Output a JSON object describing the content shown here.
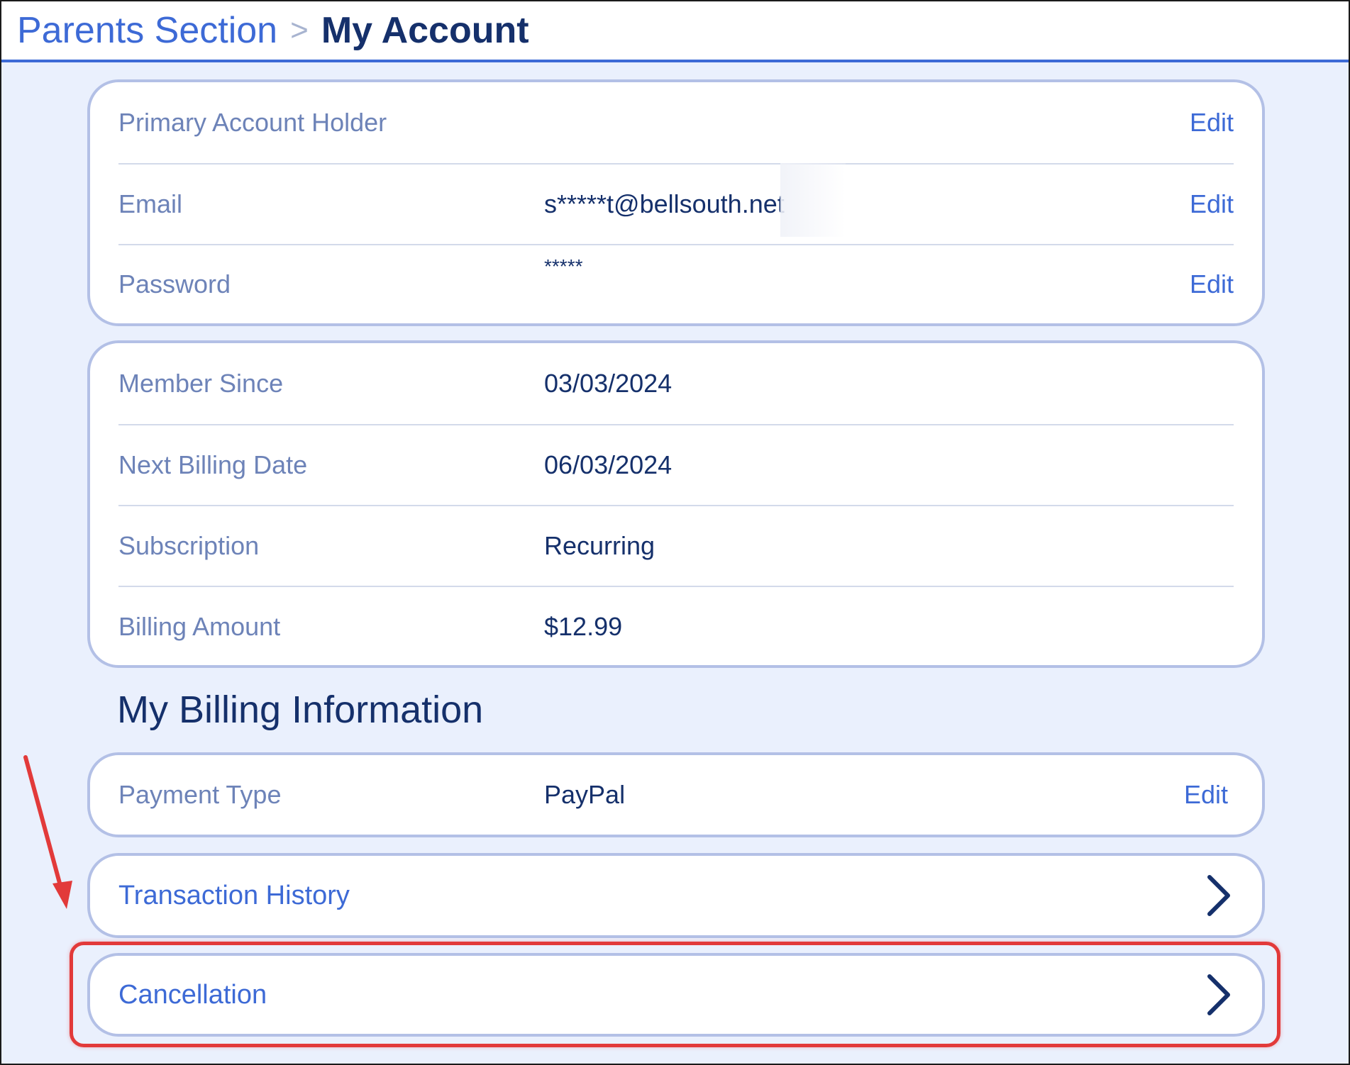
{
  "breadcrumb": {
    "parent": "Parents Section",
    "separator": ">",
    "current": "My Account"
  },
  "account_card": {
    "rows": [
      {
        "label": "Primary Account Holder",
        "value": "",
        "action": "Edit"
      },
      {
        "label": "Email",
        "value": "s*****t@bellsouth.net",
        "action": "Edit"
      },
      {
        "label": "Password",
        "value": "*****",
        "action": "Edit"
      }
    ]
  },
  "membership_card": {
    "rows": [
      {
        "label": "Member Since",
        "value": "03/03/2024"
      },
      {
        "label": "Next Billing Date",
        "value": "06/03/2024"
      },
      {
        "label": "Subscription",
        "value": "Recurring"
      },
      {
        "label": "Billing Amount",
        "value": "$12.99"
      }
    ]
  },
  "billing": {
    "title": "My Billing Information",
    "payment": {
      "label": "Payment Type",
      "value": "PayPal",
      "action": "Edit"
    },
    "transaction_history": {
      "label": "Transaction History",
      "icon": "chevron-right-icon"
    },
    "cancellation": {
      "label": "Cancellation",
      "icon": "chevron-right-icon"
    }
  },
  "annotations": {
    "highlight_color": "#e23a3a",
    "arrow_color": "#e23a3a"
  },
  "colors": {
    "accent": "#3d6ad6",
    "dark_text": "#15306b",
    "muted_label": "#6d83b8",
    "background": "#eaf0fd",
    "card_border": "#b3c0e6"
  }
}
